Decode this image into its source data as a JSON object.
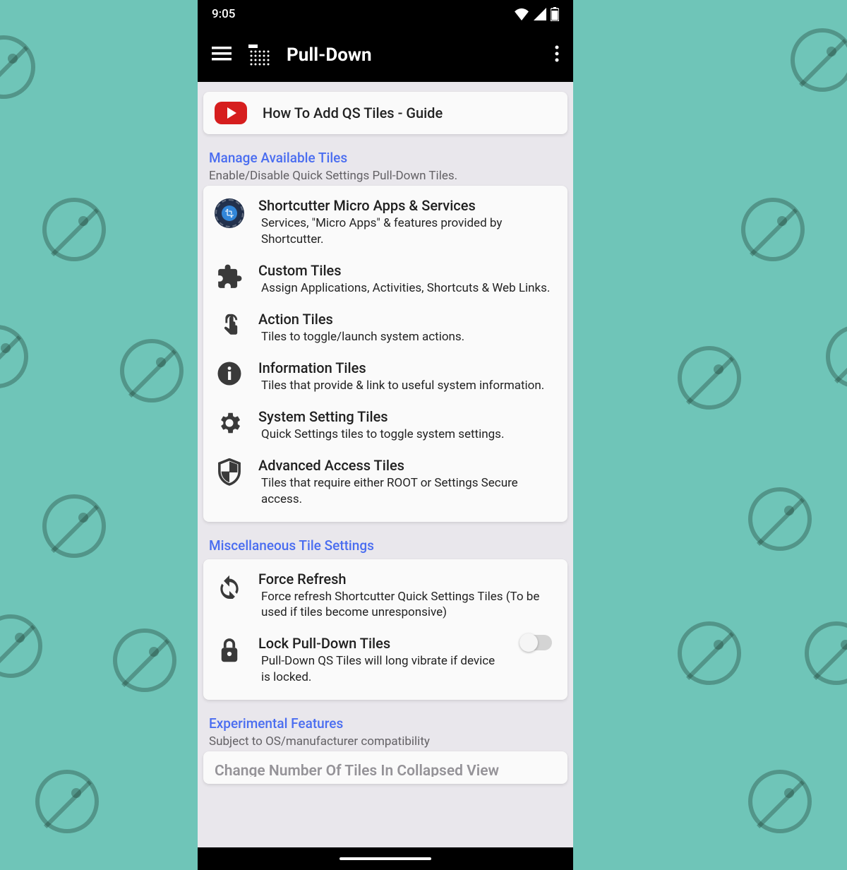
{
  "statusbar": {
    "time": "9:05"
  },
  "appbar": {
    "title": "Pull-Down"
  },
  "guide": {
    "title": "How To Add QS Tiles - Guide"
  },
  "sections": {
    "manage": {
      "title": "Manage Available Tiles",
      "sub": "Enable/Disable Quick Settings Pull-Down Tiles.",
      "items": [
        {
          "title": "Shortcutter Micro Apps & Services",
          "desc": "Services, \"Micro Apps\" & features provided by Shortcutter."
        },
        {
          "title": "Custom Tiles",
          "desc": "Assign Applications, Activities, Shortcuts & Web Links."
        },
        {
          "title": "Action Tiles",
          "desc": "Tiles to toggle/launch system actions."
        },
        {
          "title": "Information Tiles",
          "desc": "Tiles that provide & link to useful system information."
        },
        {
          "title": "System Setting Tiles",
          "desc": "Quick Settings tiles to toggle system settings."
        },
        {
          "title": "Advanced Access Tiles",
          "desc": "Tiles that require either ROOT or Settings Secure access."
        }
      ]
    },
    "misc": {
      "title": "Miscellaneous Tile Settings",
      "items": [
        {
          "title": "Force Refresh",
          "desc": "Force refresh Shortcutter Quick Settings Tiles (To be used if tiles become unresponsive)"
        },
        {
          "title": "Lock Pull-Down Tiles",
          "desc": "Pull-Down QS Tiles will long vibrate if device is locked.",
          "toggle": false
        }
      ]
    },
    "experimental": {
      "title": "Experimental Features",
      "sub": "Subject to OS/manufacturer compatibility",
      "cutoff": "Change Number Of Tiles In Collapsed View"
    }
  }
}
